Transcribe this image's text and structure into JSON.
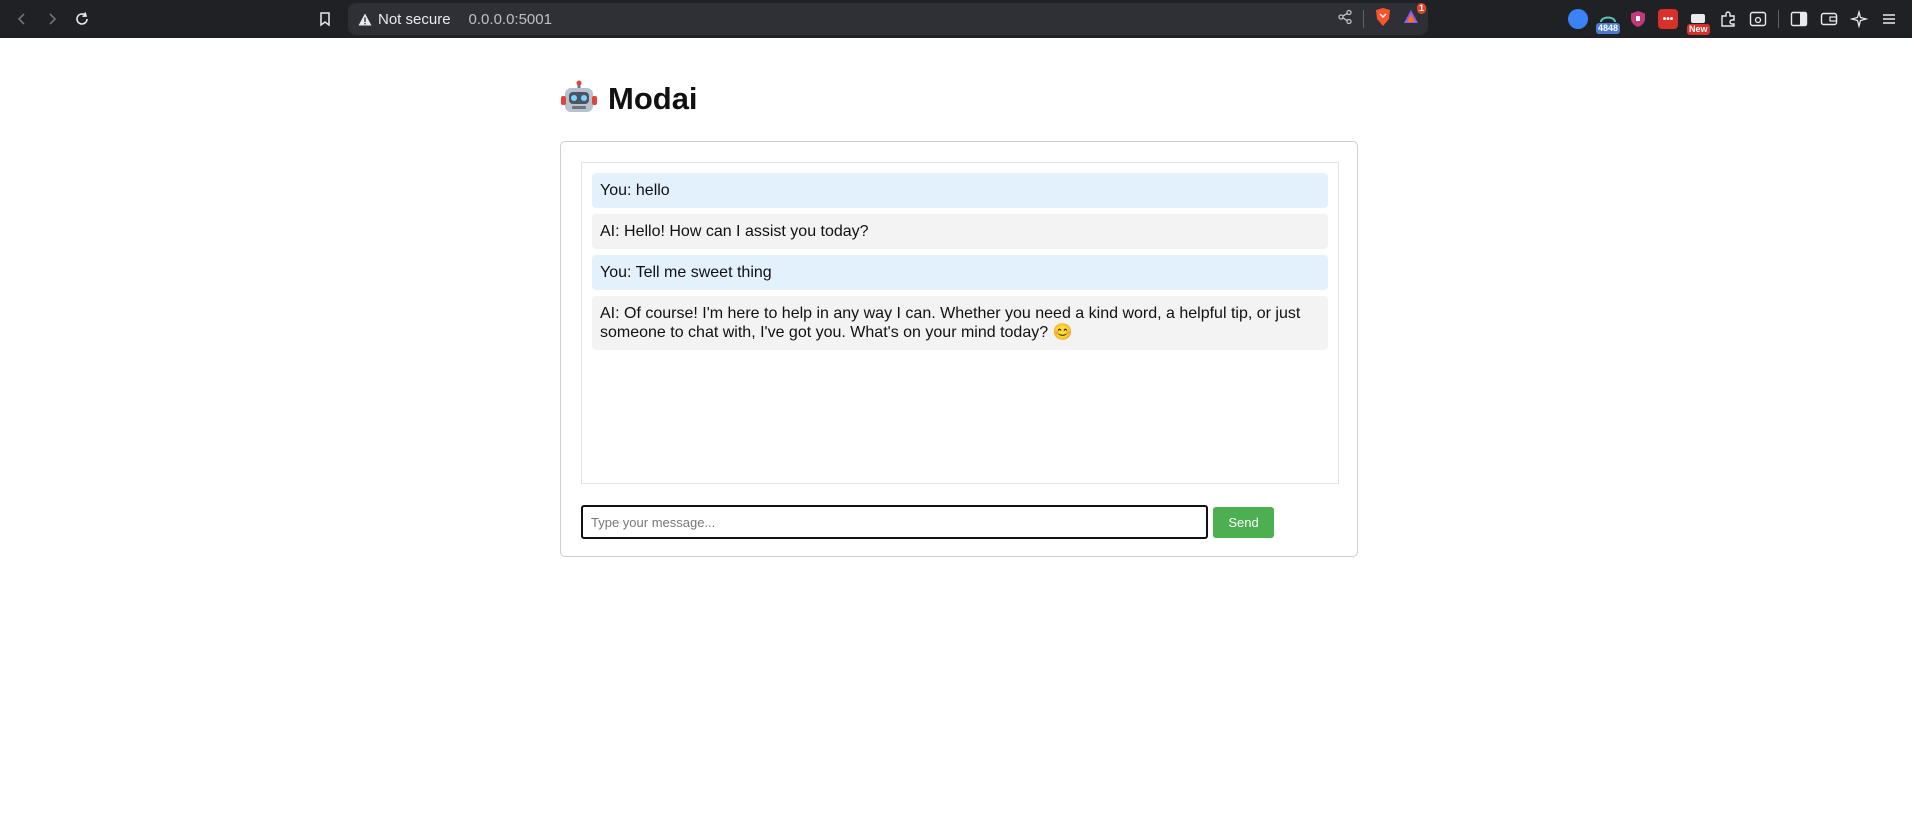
{
  "browser": {
    "security_label": "Not secure",
    "url": "0.0.0.0:5001",
    "extension_badge_count": "4848",
    "extension_new_badge": "New",
    "notification_count": "1"
  },
  "app": {
    "title": "Modai",
    "logo_icon": "robot-icon"
  },
  "chat": {
    "messages": [
      {
        "role": "user",
        "text": "You: hello"
      },
      {
        "role": "ai",
        "text": "AI: Hello! How can I assist you today?"
      },
      {
        "role": "user",
        "text": "You: Tell me sweet thing"
      },
      {
        "role": "ai",
        "text": "AI: Of course! I'm here to help in any way I can. Whether you need a kind word, a helpful tip, or just someone to chat with, I've got you. What's on your mind today? 😊"
      }
    ],
    "input_placeholder": "Type your message...",
    "input_value": "",
    "send_label": "Send"
  },
  "colors": {
    "user_bubble": "#e3f1fc",
    "ai_bubble": "#f3f3f3",
    "send_button": "#4caf50"
  }
}
